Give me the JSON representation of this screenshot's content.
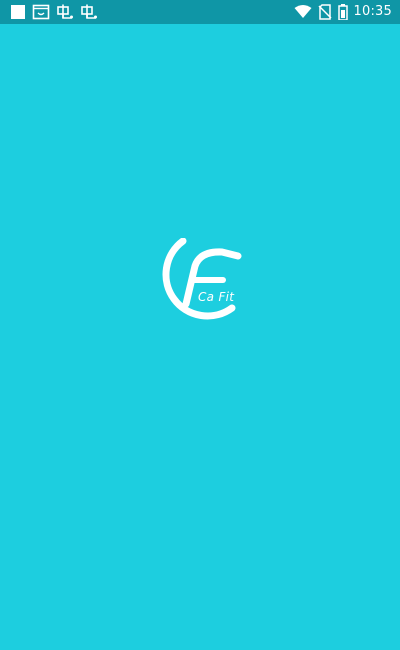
{
  "status_bar": {
    "time": "10:35",
    "left_icons": [
      "stop-square-icon",
      "screenshot-icon",
      "bug-icon",
      "bug-icon"
    ],
    "right_icons": [
      "wifi-icon",
      "no-sim-icon",
      "battery-icon"
    ]
  },
  "splash": {
    "app_name": "Ca Fit",
    "logo_icon": "cafit-logo-icon",
    "colors": {
      "background": "#1dcedf",
      "status_bar": "#0f96a6",
      "logo": "#ffffff"
    }
  }
}
